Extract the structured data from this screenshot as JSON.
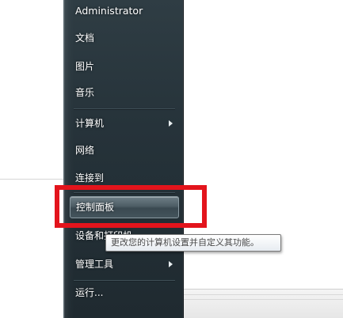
{
  "start_menu": {
    "user_name": "Administrator",
    "items": [
      {
        "label": "文档"
      },
      {
        "label": "图片"
      },
      {
        "label": "音乐"
      },
      {
        "label": "计算机"
      },
      {
        "label": "网络"
      },
      {
        "label": "连接到"
      },
      {
        "label": "控制面板"
      },
      {
        "label": "设备和打印机"
      },
      {
        "label": "管理工具"
      },
      {
        "label": "运行..."
      }
    ]
  },
  "tooltip": {
    "text": "更改您的计算机设置并自定义其功能。"
  },
  "colors": {
    "highlight": "#e3141c",
    "menu_background": "#26333a"
  }
}
